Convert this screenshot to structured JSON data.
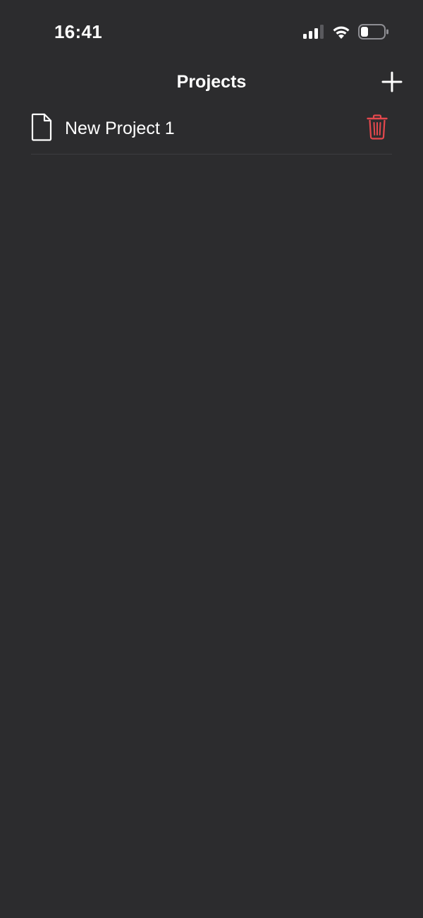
{
  "status_bar": {
    "time": "16:41",
    "icons": [
      "cellular-signal-icon",
      "wifi-icon",
      "battery-icon"
    ]
  },
  "nav": {
    "title": "Projects",
    "add_icon": "plus-icon"
  },
  "projects": [
    {
      "name": "New Project 1",
      "icon": "document-icon",
      "action_icon": "trash-icon"
    }
  ],
  "colors": {
    "background": "#2c2c2e",
    "text": "#ffffff",
    "destructive": "#e5484d",
    "separator": "#3d3d40"
  }
}
